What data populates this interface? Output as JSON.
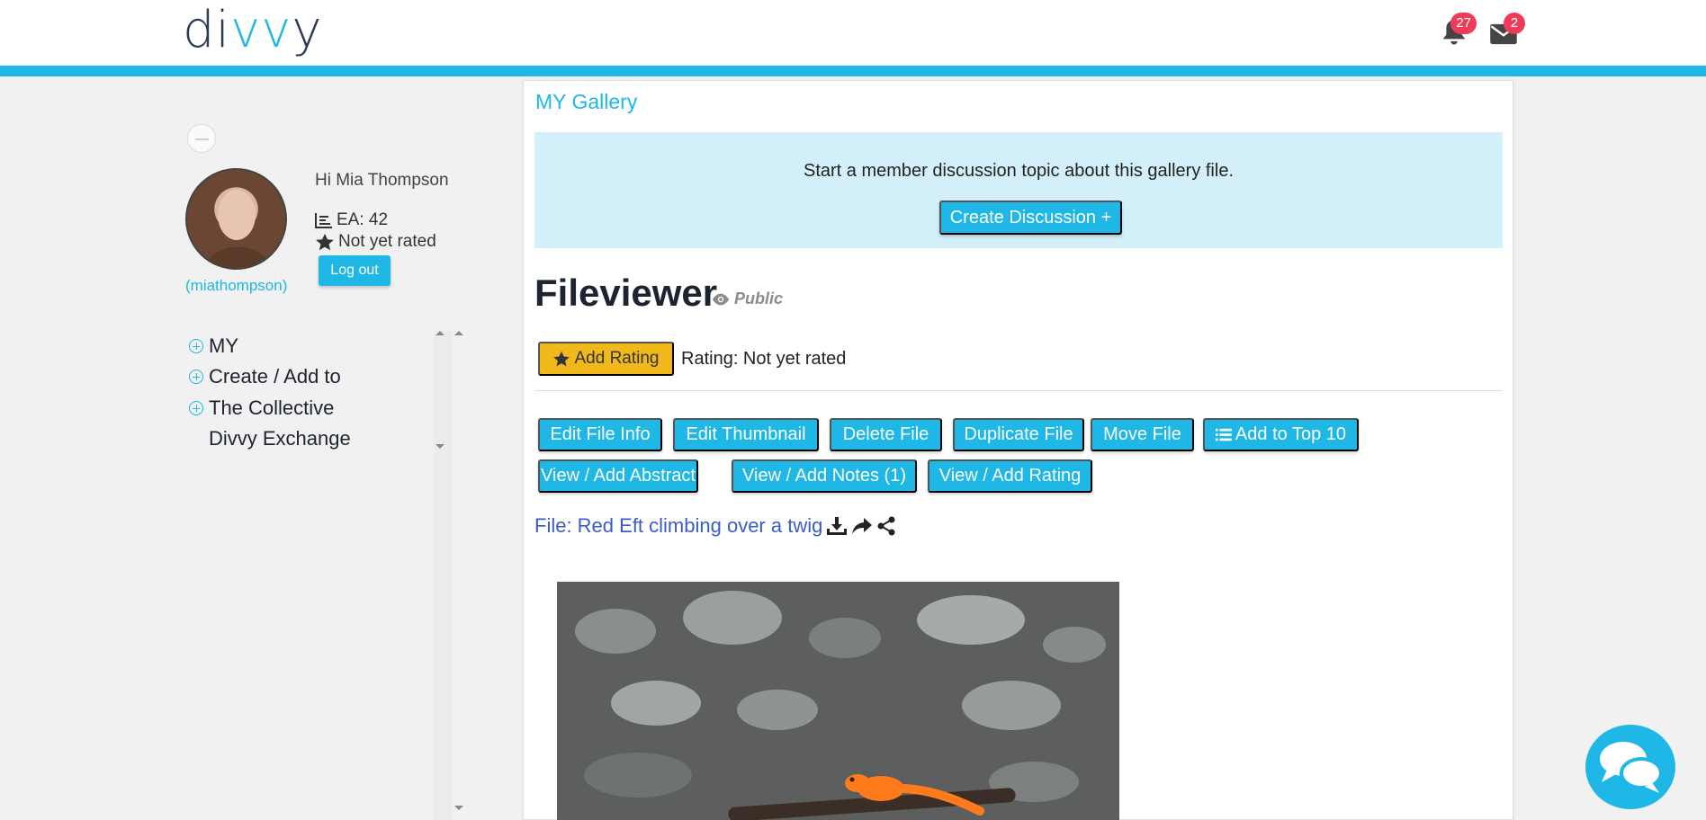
{
  "header": {
    "logo_text": "divvy",
    "notifications_count": "27",
    "messages_count": "2"
  },
  "profile": {
    "greeting": "Hi Mia Thompson",
    "username": "(miathompson)",
    "ea": "EA: 42",
    "rating": "Not yet rated",
    "logout_label": "Log out"
  },
  "nav": {
    "items": [
      {
        "label": "MY",
        "expandable": true
      },
      {
        "label": "Create / Add to",
        "expandable": true
      },
      {
        "label": "The Collective",
        "expandable": true
      },
      {
        "label": "Divvy Exchange",
        "expandable": false
      }
    ]
  },
  "main": {
    "breadcrumb": "MY Gallery",
    "discussion_text": "Start a member discussion topic about this gallery file.",
    "create_discussion_label": "Create Discussion +",
    "title": "Fileviewer",
    "visibility": "Public",
    "add_rating_label": "Add Rating",
    "rating_text": "Rating: Not yet rated",
    "actions_row1": [
      "Edit File Info",
      "Edit Thumbnail",
      "Delete File",
      "Duplicate File",
      "Move File",
      "Add to Top 10"
    ],
    "actions_row2": [
      "View / Add Abstract",
      "View / Add Notes (1)",
      "View / Add Rating"
    ],
    "file_label": "File: Red Eft climbing over a twig"
  },
  "colors": {
    "accent": "#1eb7e6",
    "rating_button": "#f0b81b",
    "badge": "#ef3b5a",
    "discussion_bg": "#d3f0fa",
    "file_link": "#3b5cc4"
  },
  "icons": [
    "bell-icon",
    "envelope-icon",
    "bar-chart-icon",
    "star-icon",
    "eye-icon",
    "list-icon",
    "download-icon",
    "share-arrow-icon",
    "share-nodes-icon",
    "chat-bubbles-icon"
  ]
}
